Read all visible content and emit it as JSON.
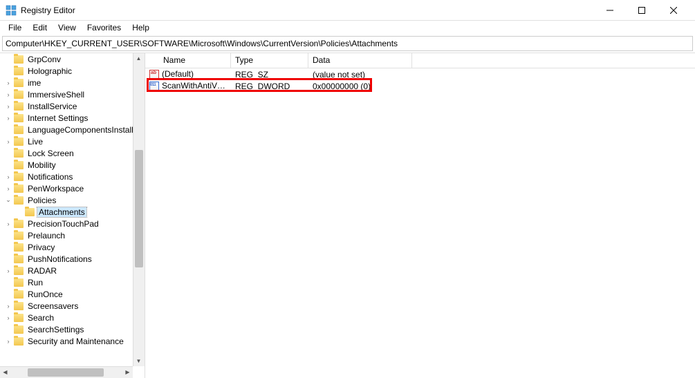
{
  "window": {
    "title": "Registry Editor"
  },
  "menu": {
    "items": [
      "File",
      "Edit",
      "View",
      "Favorites",
      "Help"
    ]
  },
  "address": "Computer\\HKEY_CURRENT_USER\\SOFTWARE\\Microsoft\\Windows\\CurrentVersion\\Policies\\Attachments",
  "tree": {
    "items": [
      {
        "label": "GrpConv",
        "depth": 1,
        "toggle": ""
      },
      {
        "label": "Holographic",
        "depth": 1,
        "toggle": ""
      },
      {
        "label": "ime",
        "depth": 1,
        "toggle": ">"
      },
      {
        "label": "ImmersiveShell",
        "depth": 1,
        "toggle": ">"
      },
      {
        "label": "InstallService",
        "depth": 1,
        "toggle": ">"
      },
      {
        "label": "Internet Settings",
        "depth": 1,
        "toggle": ">"
      },
      {
        "label": "LanguageComponentsInstaller",
        "depth": 1,
        "toggle": ""
      },
      {
        "label": "Live",
        "depth": 1,
        "toggle": ">"
      },
      {
        "label": "Lock Screen",
        "depth": 1,
        "toggle": ""
      },
      {
        "label": "Mobility",
        "depth": 1,
        "toggle": ""
      },
      {
        "label": "Notifications",
        "depth": 1,
        "toggle": ">"
      },
      {
        "label": "PenWorkspace",
        "depth": 1,
        "toggle": ">"
      },
      {
        "label": "Policies",
        "depth": 1,
        "toggle": "v"
      },
      {
        "label": "Attachments",
        "depth": 2,
        "toggle": "",
        "selected": true
      },
      {
        "label": "PrecisionTouchPad",
        "depth": 1,
        "toggle": ">"
      },
      {
        "label": "Prelaunch",
        "depth": 1,
        "toggle": ""
      },
      {
        "label": "Privacy",
        "depth": 1,
        "toggle": ""
      },
      {
        "label": "PushNotifications",
        "depth": 1,
        "toggle": ""
      },
      {
        "label": "RADAR",
        "depth": 1,
        "toggle": ">"
      },
      {
        "label": "Run",
        "depth": 1,
        "toggle": ""
      },
      {
        "label": "RunOnce",
        "depth": 1,
        "toggle": ""
      },
      {
        "label": "Screensavers",
        "depth": 1,
        "toggle": ">"
      },
      {
        "label": "Search",
        "depth": 1,
        "toggle": ">"
      },
      {
        "label": "SearchSettings",
        "depth": 1,
        "toggle": ""
      },
      {
        "label": "Security and Maintenance",
        "depth": 1,
        "toggle": ">"
      }
    ]
  },
  "list": {
    "columns": [
      "Name",
      "Type",
      "Data"
    ],
    "rows": [
      {
        "name": "(Default)",
        "type": "REG_SZ",
        "data": "(value not set)",
        "iconType": "sz"
      },
      {
        "name": "ScanWithAntiVir...",
        "type": "REG_DWORD",
        "data": "0x00000000 (0)",
        "iconType": "dw"
      }
    ]
  }
}
